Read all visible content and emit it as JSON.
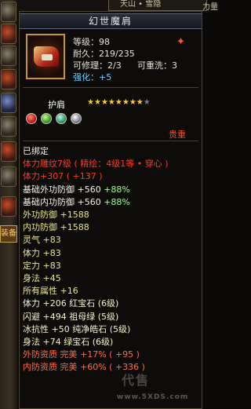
{
  "top": {
    "tab_label": "天山 • 雪隐",
    "edge_label": "力量"
  },
  "left_strip": {
    "tab_label": "装备"
  },
  "item": {
    "name": "幻世魔肩",
    "level_label": "等级：",
    "level_value": "98",
    "durability_label": "耐久：",
    "durability_value": "219/235",
    "repair_label": "可修理：",
    "repair_value": "2/3",
    "rewash_label": "可重洗：",
    "rewash_value": "3",
    "enhance_label": "强化：",
    "enhance_value": "+5",
    "slot_label": "护肩",
    "stars_filled": 8,
    "stars_total": 9,
    "value_tag": "贵重",
    "gems": [
      "red",
      "green",
      "green2",
      "silver"
    ]
  },
  "attributes": [
    {
      "text": "已绑定",
      "color": "white"
    },
    {
      "text": "体力雕纹7级 ( 精绘：4级1等 • 穿心 )",
      "color": "red"
    },
    {
      "text": "体力+307 ( +137 )",
      "color": "red"
    },
    {
      "text": "基础外功防御 +560 ",
      "extra": "+88%",
      "color": "white"
    },
    {
      "text": "基础内功防御 +560 ",
      "extra": "+88%",
      "color": "white"
    },
    {
      "text": "外功防御 +1588",
      "color": "yellow"
    },
    {
      "text": "内功防御 +1588",
      "color": "yellow"
    },
    {
      "text": "灵气 +83",
      "color": "yellow"
    },
    {
      "text": "体力 +83",
      "color": "yellow"
    },
    {
      "text": "定力 +83",
      "color": "yellow"
    },
    {
      "text": "身法 +45",
      "color": "yellow"
    },
    {
      "text": "所有属性 +16",
      "color": "yellow"
    },
    {
      "text": "体力 +206 红宝石 (6级)",
      "color": "bright"
    },
    {
      "text": "闪避 +494 祖母绿 (5级)",
      "color": "bright"
    },
    {
      "text": "冰抗性 +50 纯净皓石 (5级)",
      "color": "bright"
    },
    {
      "text": "身法 +74 绿宝石 (6级)",
      "color": "bright"
    },
    {
      "text": "外防资质  完美 +17% ( +95 )",
      "color": "orange"
    },
    {
      "text": "内防资质  完美 +60% ( +336 )",
      "color": "orange"
    }
  ],
  "watermark": {
    "text": "代售",
    "domain": "www.5XDS.com"
  },
  "colors": {
    "red": "#ff3a24",
    "yellow": "#e8e68a",
    "green_percent": "#9dff8e",
    "blue_label": "#6fd3ff",
    "gold_star": "#ffcc33"
  }
}
